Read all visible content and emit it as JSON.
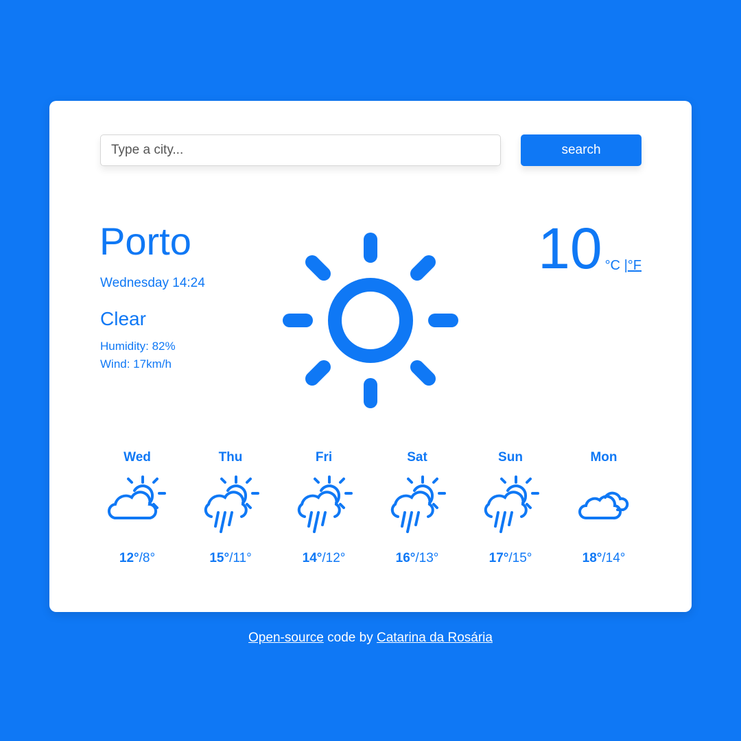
{
  "search": {
    "placeholder": "Type a city...",
    "button_label": "search"
  },
  "current": {
    "city": "Porto",
    "datetime": "Wednesday 14:24",
    "description": "Clear",
    "humidity": "Humidity: 82%",
    "wind": "Wind: 17km/h",
    "temperature": "10",
    "unit_celsius": "°C",
    "unit_separator": "|",
    "unit_fahrenheit": "°F",
    "icon": "sun-icon"
  },
  "forecast": [
    {
      "day": "Wed",
      "max": "12°",
      "min": "/8°",
      "icon": "partly-cloudy-icon"
    },
    {
      "day": "Thu",
      "max": "15°",
      "min": "/11°",
      "icon": "rain-sun-icon"
    },
    {
      "day": "Fri",
      "max": "14°",
      "min": "/12°",
      "icon": "rain-sun-icon"
    },
    {
      "day": "Sat",
      "max": "16°",
      "min": "/13°",
      "icon": "rain-sun-icon"
    },
    {
      "day": "Sun",
      "max": "17°",
      "min": "/15°",
      "icon": "rain-sun-icon"
    },
    {
      "day": "Mon",
      "max": "18°",
      "min": "/14°",
      "icon": "cloudy-icon"
    }
  ],
  "footer": {
    "link1": "Open-source",
    "middle": " code by ",
    "link2": "Catarina da Rosária"
  },
  "colors": {
    "background": "#0f78f5",
    "accent": "#0f78f5",
    "card": "#ffffff"
  }
}
